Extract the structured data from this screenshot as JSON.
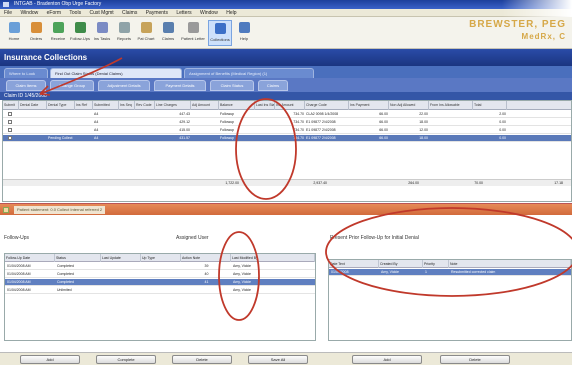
{
  "window": {
    "title": "INTGAB - Bradenton Obp Urge Factory"
  },
  "menu": {
    "items": [
      "File",
      "Window",
      "eForm",
      "Tools",
      "Cust Mgmt",
      "Claims",
      "Payments",
      "Letters",
      "Window",
      "Help"
    ]
  },
  "toolbar": {
    "buttons": [
      {
        "label": "Home",
        "icon": "home-icon"
      },
      {
        "label": "Orders",
        "icon": "orders-icon"
      },
      {
        "label": "Receive",
        "icon": "receive-icon"
      },
      {
        "label": "Follow-Ups",
        "icon": "followup-icon"
      },
      {
        "label": "Ins Tasks",
        "icon": "tasks-icon"
      },
      {
        "label": "Reports",
        "icon": "reports-icon"
      },
      {
        "label": "Pat Chart",
        "icon": "chart-icon"
      },
      {
        "label": "Claims",
        "icon": "claims-icon"
      },
      {
        "label": "Patient Letter",
        "icon": "letter-icon"
      },
      {
        "label": "Collections",
        "icon": "collections-icon"
      },
      {
        "label": "Help",
        "icon": "help-icon"
      }
    ]
  },
  "brand": {
    "line1": "BREWSTER, PEG",
    "line2": "MedRx, C"
  },
  "section": {
    "title": "Insurance Collections"
  },
  "subtabs": [
    "Where to Look",
    "Find Out Claim Status (Denial Claims)",
    "Assignment of Benefits (Medical Region) (1)"
  ],
  "actiontabs": [
    "Claim Items",
    "Change Group",
    "Adjustment Details",
    "Payment Details",
    "Claim Status",
    "Claims"
  ],
  "panel": {
    "header": "Claim ID 1/45/2008"
  },
  "grid": {
    "columns": [
      "Submit",
      "Denial Date",
      "Denial Type",
      "Ins Ref",
      "Submitted",
      "Ins Seq",
      "Rev Code",
      "Line Charges",
      "Adj Amount",
      "Balance",
      "Last Ins Status",
      "Ins Amount",
      "Charge Code",
      "Ins Payment",
      "Non Adj Allowed",
      "From Ins Allowable",
      "Total"
    ],
    "rows": [
      {
        "cells": [
          "",
          "",
          "",
          "",
          "A4",
          "",
          "",
          "447.43",
          "",
          "Followup",
          "",
          "734.70",
          "CLA2 0098 1/4/2008",
          "66.00",
          "22.00",
          "",
          "2.00"
        ]
      },
      {
        "cells": [
          "",
          "",
          "",
          "",
          "A4",
          "",
          "",
          "429.12",
          "",
          "Followup",
          "",
          "734.70",
          "E1 09877 2/4/2008",
          "66.00",
          "18.00",
          "",
          "0.00"
        ]
      },
      {
        "cells": [
          "",
          "",
          "",
          "",
          "A4",
          "",
          "",
          "415.00",
          "",
          "Followup",
          "",
          "734.70",
          "E1 09877 2/4/2008",
          "66.00",
          "12.00",
          "",
          "0.00"
        ]
      },
      {
        "cells": [
          "",
          "",
          "Pending Collect",
          "",
          "A4",
          "",
          "",
          "431.57",
          "",
          "Followup",
          "",
          "734.70",
          "E1 09877 2/4/2008",
          "66.00",
          "18.00",
          "",
          "0.00"
        ]
      }
    ],
    "totals": {
      "charges": "1,722.00",
      "adjusted": "2,937.40",
      "payment": "264.00",
      "allowed": "70.00",
      "balance": "17.18"
    }
  },
  "note": {
    "text": "Patient statement: 0.0 Collect Internal referred 2"
  },
  "followups": {
    "title": "Follow-Ups",
    "assignee_label": "Assigned User",
    "columns": [
      "Follow-Up Date",
      "Status",
      "Last Update",
      "Up Type",
      "Action Note",
      "Last Modified By"
    ],
    "rows": [
      {
        "cells": [
          "01/04/2008 AM",
          "Completed",
          "",
          "",
          "39",
          "Amy, Vickie"
        ]
      },
      {
        "cells": [
          "01/04/2008 AM",
          "Completed",
          "",
          "",
          "40",
          "Amy, Vickie"
        ]
      },
      {
        "cells": [
          "01/04/2008 AM",
          "Completed",
          "",
          "",
          "41",
          "Amy, Vickie"
        ]
      },
      {
        "cells": [
          "01/04/2008 AM",
          "Unlimited",
          "",
          "",
          "",
          "Amy, Vickie"
        ]
      }
    ]
  },
  "notes_panel": {
    "title": "Present Prior Follow-Up for Initial Denial",
    "columns": [
      "Date Text",
      "Created By",
      "Priority",
      "Note"
    ],
    "rows": [
      {
        "cells": [
          "01/04/2008",
          "Amy, Vickie",
          "1",
          "Resubmitted corrected claim"
        ]
      }
    ]
  },
  "bottom_buttons": [
    "Add",
    "Complete",
    "Delete",
    "Save All",
    "Add",
    "Delete"
  ],
  "annotation_color": "#c0392b"
}
